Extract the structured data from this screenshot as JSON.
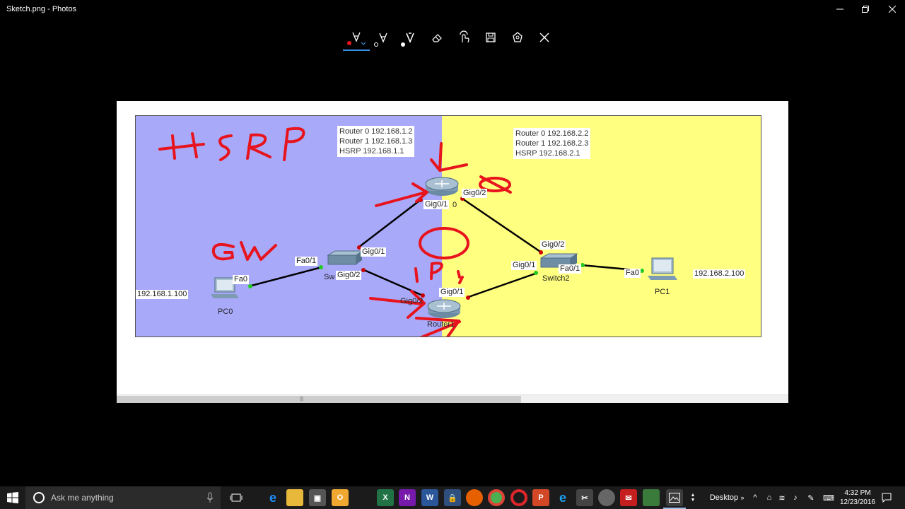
{
  "window": {
    "title": "Sketch.png - Photos"
  },
  "toolbar": {
    "tools": [
      "ballpoint-pen",
      "pencil",
      "calligraphy-pen",
      "eraser",
      "touch-writing",
      "save",
      "share",
      "close"
    ]
  },
  "diagram": {
    "notes": {
      "left": "Router 0 192.168.1.2\nRouter 1 192.168.1.3\nHSRP 192.168.1.1",
      "right": "Router 0 192.168.2.2\nRouter 1 192.168.2.3\nHSRP 192.168.2.1"
    },
    "ports": {
      "r0_gig01": "Gig0/1",
      "r0_gig02": "Gig0/2",
      "sw1_fa01": "Fa0/1",
      "sw1_gig01": "Gig0/1",
      "sw1_gig02": "Gig0/2",
      "r1_gig01": "Gig0/1",
      "r1_gig02": "Gig0/2",
      "sw2_gig02": "Gig0/2",
      "sw2_gig01": "Gig0/1",
      "sw2_fa01": "Fa0/1",
      "pc0_fa0": "Fa0",
      "pc1_fa0": "Fa0"
    },
    "devices": {
      "router0": "0",
      "router1": "Router1",
      "switch1": "Sw",
      "switch2": "Switch2",
      "pc0": "PC0",
      "pc1": "PC1"
    },
    "addresses": {
      "pc0": "192.168.1.100",
      "pc1": "192.168.2.100"
    },
    "annotations": {
      "hsrp": "HSRP",
      "gw": "GW",
      "ip": "IP,"
    },
    "colors": {
      "left_zone": "#a9a9fa",
      "right_zone": "#ffff80",
      "ink": "#e8141d",
      "link_up": "#22cc22",
      "link_down": "#cc0000"
    }
  },
  "taskbar": {
    "search_placeholder": "Ask me anything",
    "apps": [
      "file-explorer",
      "edge",
      "folder",
      "store",
      "outlook",
      "excel",
      "onenote",
      "word",
      "keepass",
      "firefox",
      "chrome",
      "opera",
      "powerpoint",
      "ie",
      "snipping",
      "paint",
      "mail",
      "network",
      "photos"
    ],
    "desktop_label": "Desktop",
    "time": "4:32 PM",
    "date": "12/23/2016"
  }
}
